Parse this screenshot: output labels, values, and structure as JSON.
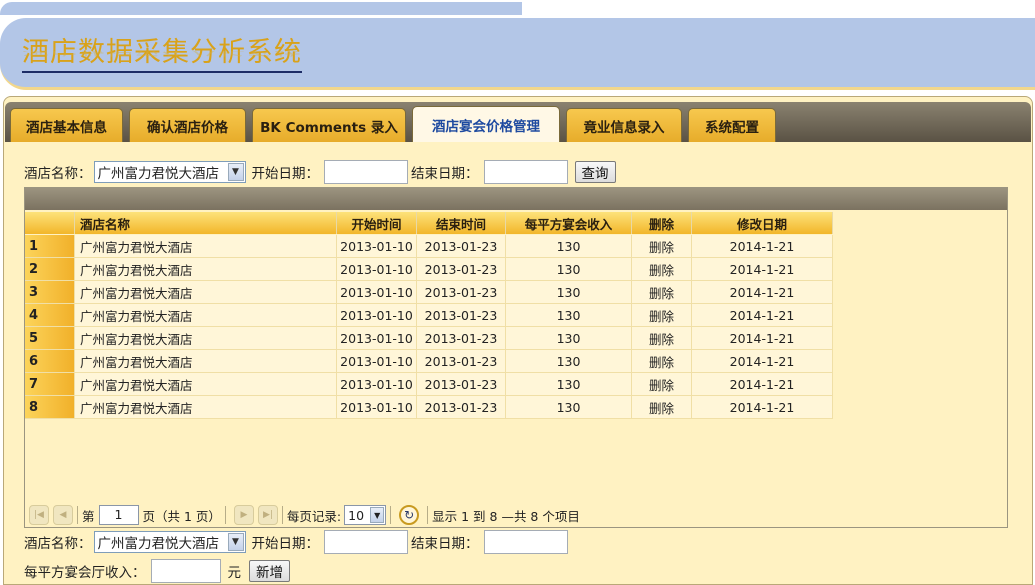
{
  "app": {
    "title": "酒店数据采集分析系统"
  },
  "tabs": [
    {
      "label": "酒店基本信息"
    },
    {
      "label": "确认酒店价格"
    },
    {
      "label": "BK Comments 录入"
    },
    {
      "label": "酒店宴会价格管理",
      "active": true
    },
    {
      "label": "竟业信息录入"
    },
    {
      "label": "系统配置"
    }
  ],
  "search": {
    "hotel_label": "酒店名称：",
    "hotel_value": "广州富力君悦大酒店",
    "start_label": "开始日期：",
    "start_value": "",
    "end_label": "结束日期：",
    "end_value": "",
    "query_button": "查询"
  },
  "grid": {
    "columns": [
      "酒店名称",
      "开始时间",
      "结束时间",
      "每平方宴会收入",
      "删除",
      "修改日期"
    ],
    "rows": [
      {
        "num": "1",
        "hotel": "广州富力君悦大酒店",
        "start": "2013-01-10",
        "end": "2013-01-23",
        "income": "130",
        "del": "删除",
        "modified": "2014-1-21"
      },
      {
        "num": "2",
        "hotel": "广州富力君悦大酒店",
        "start": "2013-01-10",
        "end": "2013-01-23",
        "income": "130",
        "del": "删除",
        "modified": "2014-1-21"
      },
      {
        "num": "3",
        "hotel": "广州富力君悦大酒店",
        "start": "2013-01-10",
        "end": "2013-01-23",
        "income": "130",
        "del": "删除",
        "modified": "2014-1-21"
      },
      {
        "num": "4",
        "hotel": "广州富力君悦大酒店",
        "start": "2013-01-10",
        "end": "2013-01-23",
        "income": "130",
        "del": "删除",
        "modified": "2014-1-21"
      },
      {
        "num": "5",
        "hotel": "广州富力君悦大酒店",
        "start": "2013-01-10",
        "end": "2013-01-23",
        "income": "130",
        "del": "删除",
        "modified": "2014-1-21"
      },
      {
        "num": "6",
        "hotel": "广州富力君悦大酒店",
        "start": "2013-01-10",
        "end": "2013-01-23",
        "income": "130",
        "del": "删除",
        "modified": "2014-1-21"
      },
      {
        "num": "7",
        "hotel": "广州富力君悦大酒店",
        "start": "2013-01-10",
        "end": "2013-01-23",
        "income": "130",
        "del": "删除",
        "modified": "2014-1-21"
      },
      {
        "num": "8",
        "hotel": "广州富力君悦大酒店",
        "start": "2013-01-10",
        "end": "2013-01-23",
        "income": "130",
        "del": "删除",
        "modified": "2014-1-21"
      }
    ]
  },
  "pager": {
    "page_prefix": "第",
    "page_value": "1",
    "page_suffix": "页（共 1 页）",
    "per_page_label": "每页记录:",
    "per_page_value": "10",
    "summary": "显示 1 到 8 —共 8 个项目"
  },
  "add_form": {
    "hotel_label": "酒店名称：",
    "hotel_value": "广州富力君悦大酒店",
    "start_label": "开始日期：",
    "start_value": "",
    "end_label": "结束日期：",
    "end_value": "",
    "income_label": "每平方宴会厅收入：",
    "income_value": "",
    "unit": "元",
    "add_button": "新增"
  }
}
